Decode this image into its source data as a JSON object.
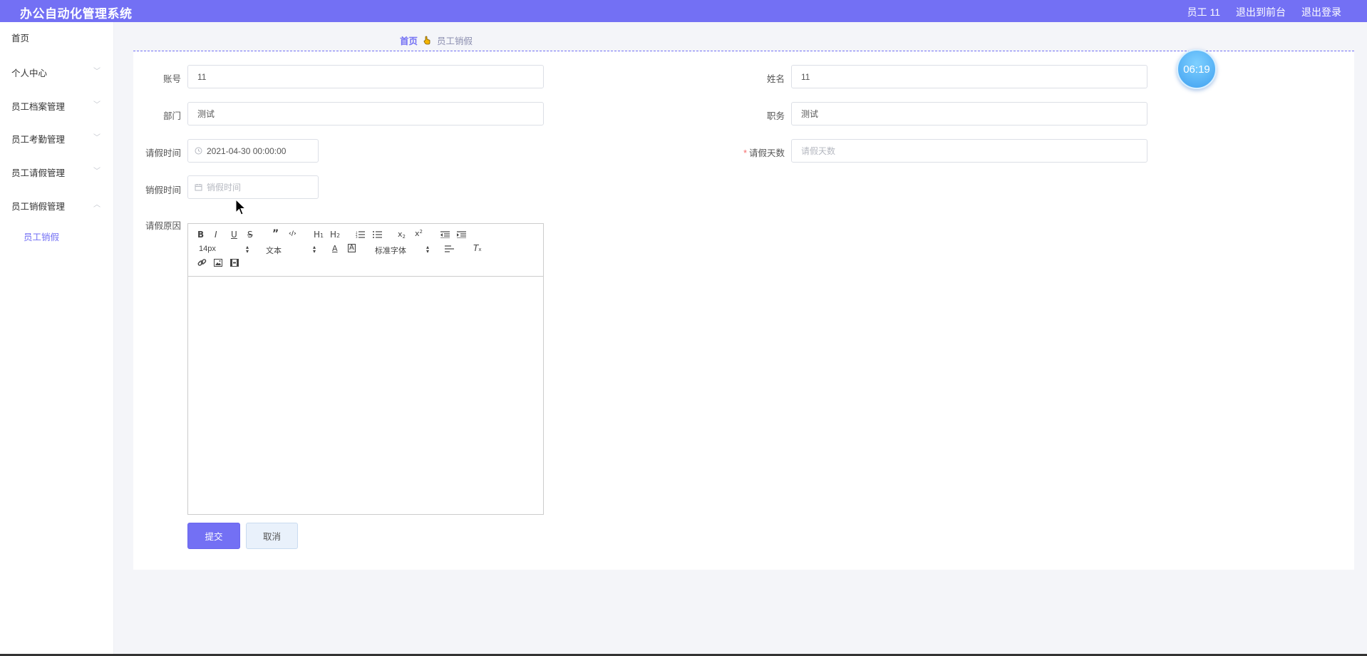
{
  "header": {
    "title": "办公自动化管理系统",
    "user": "员工 11",
    "to_front": "退出到前台",
    "logout": "退出登录"
  },
  "sidebar": {
    "items": [
      {
        "label": "首页"
      },
      {
        "label": "个人中心"
      },
      {
        "label": "员工档案管理"
      },
      {
        "label": "员工考勤管理"
      },
      {
        "label": "员工请假管理"
      },
      {
        "label": "员工销假管理"
      }
    ],
    "sub_item": "员工销假"
  },
  "breadcrumb": {
    "home": "首页",
    "current": "员工销假"
  },
  "clock": "06:19",
  "form": {
    "account": {
      "label": "账号",
      "value": "11"
    },
    "name": {
      "label": "姓名",
      "value": "11"
    },
    "department": {
      "label": "部门",
      "value": "测试"
    },
    "position": {
      "label": "职务",
      "value": "测试"
    },
    "leave_time": {
      "label": "请假时间",
      "value": "2021-04-30 00:00:00"
    },
    "leave_days": {
      "label": "请假天数",
      "required_mark": "*",
      "placeholder": "请假天数"
    },
    "cancel_time": {
      "label": "销假时间",
      "placeholder": "销假时间"
    },
    "reason": {
      "label": "请假原因"
    }
  },
  "editor": {
    "font_size": "14px",
    "text_style": "文本",
    "font_family": "标准字体"
  },
  "buttons": {
    "submit": "提交",
    "cancel": "取消"
  }
}
